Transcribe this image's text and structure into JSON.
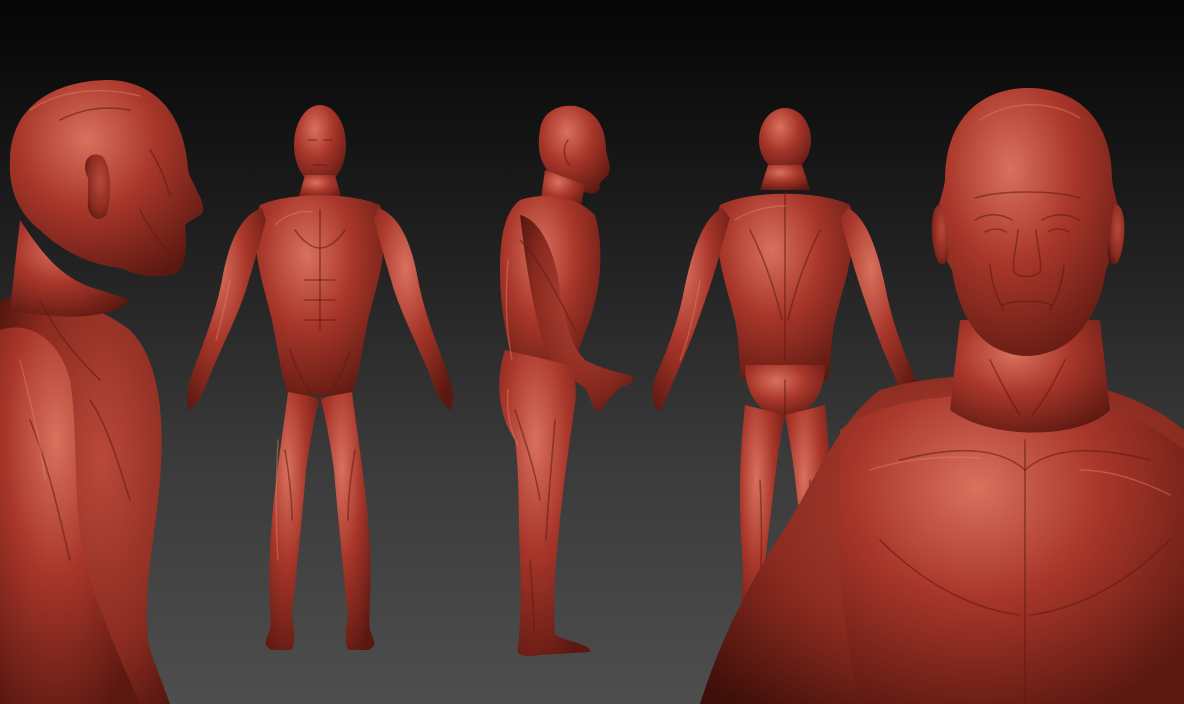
{
  "scene": {
    "subject": "sculpted-male-anatomy-figure",
    "material_color": "#a8362a",
    "highlight_color": "#d9715e",
    "shadow_color": "#4a120c",
    "background_top": "#050505",
    "background_bottom": "#4e4e4e",
    "views": [
      {
        "view": "head-profile-closeup"
      },
      {
        "view": "front-full-body"
      },
      {
        "view": "side-full-body"
      },
      {
        "view": "back-full-body"
      },
      {
        "view": "head-front-closeup"
      }
    ]
  }
}
